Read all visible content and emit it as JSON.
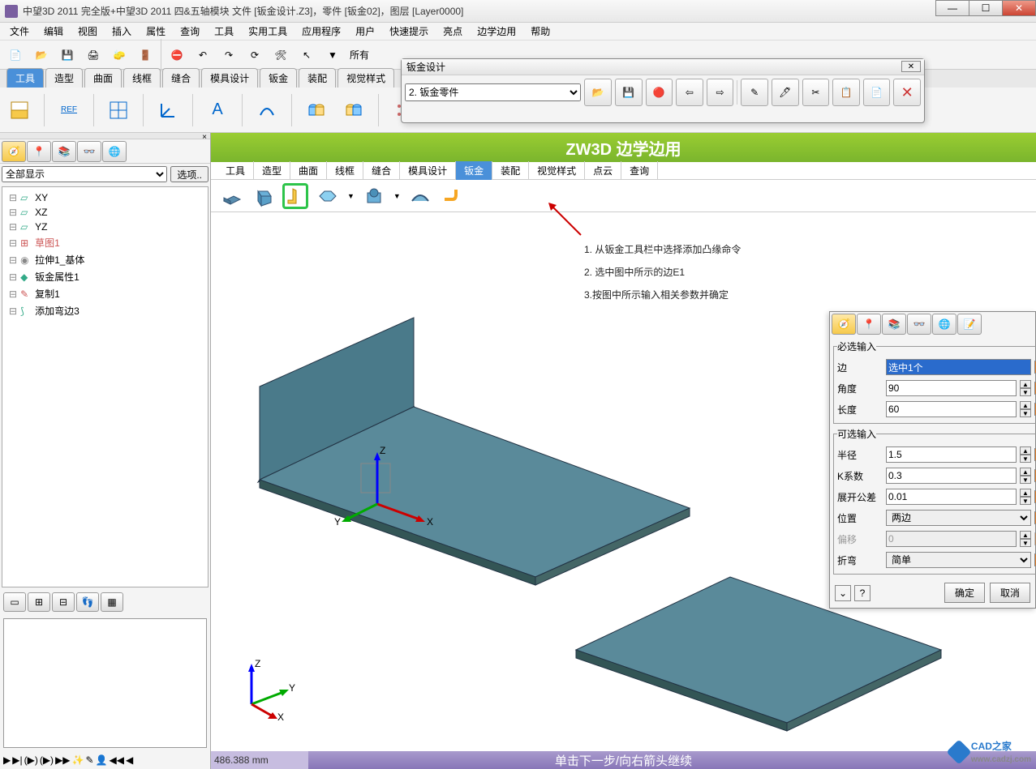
{
  "title": "中望3D 2011 完全版+中望3D 2011 四&五轴模块      文件 [钣金设计.Z3]，零件 [钣金02]，图层 [Layer0000]",
  "menu": [
    "文件",
    "编辑",
    "视图",
    "插入",
    "属性",
    "查询",
    "工具",
    "实用工具",
    "应用程序",
    "用户",
    "快速提示",
    "亮点",
    "边学边用",
    "帮助"
  ],
  "filterLabel": "所有",
  "mainTabs": [
    "工具",
    "造型",
    "曲面",
    "线框",
    "缝合",
    "模具设计",
    "钣金",
    "装配",
    "视觉样式"
  ],
  "mainActiveIdx": 0,
  "left": {
    "filter": "全部显示",
    "optionBtn": "选项..",
    "tree": [
      {
        "icon": "plane",
        "label": "XY"
      },
      {
        "icon": "plane",
        "label": "XZ"
      },
      {
        "icon": "plane",
        "label": "YZ"
      },
      {
        "icon": "sketch",
        "label": "草图1"
      },
      {
        "icon": "feat",
        "label": "拉伸1_基体"
      },
      {
        "icon": "sm",
        "label": "钣金属性1"
      },
      {
        "icon": "copy",
        "label": "复制1"
      },
      {
        "icon": "bend",
        "label": "添加弯边3"
      }
    ]
  },
  "floatToolbar": {
    "title": "钣金设计",
    "dropdown": "2. 钣金零件"
  },
  "banner": "ZW3D 边学边用",
  "innerTabs": [
    "工具",
    "造型",
    "曲面",
    "线框",
    "缝合",
    "模具设计",
    "钣金",
    "装配",
    "视觉样式",
    "点云",
    "查询"
  ],
  "innerActiveIdx": 6,
  "instructions": {
    "l1": "1. 从钣金工具栏中选择添加凸缘命令",
    "l2": "2. 选中图中所示的边E1",
    "l3": "3.按图中所示输入相关参数并确定"
  },
  "panel": {
    "group1": "必选输入",
    "group2": "可选输入",
    "rows": {
      "edge": {
        "label": "边",
        "value": "选中1个"
      },
      "angle": {
        "label": "角度",
        "value": "90"
      },
      "length": {
        "label": "长度",
        "value": "60"
      },
      "radius": {
        "label": "半径",
        "value": "1.5"
      },
      "kfactor": {
        "label": "K系数",
        "value": "0.3"
      },
      "tol": {
        "label": "展开公差",
        "value": "0.01"
      },
      "pos": {
        "label": "位置",
        "value": "两边"
      },
      "offset": {
        "label": "偏移",
        "value": "0"
      },
      "bend": {
        "label": "折弯",
        "value": "简单"
      }
    },
    "ok": "确定",
    "cancel": "取消"
  },
  "statusHint": "单击下一步/向右箭头继续",
  "statusMM": "486.388 mm",
  "watermark": {
    "brand": "CAD之家",
    "url": "www.cadzj.com"
  },
  "axisLabels": {
    "x": "X",
    "y": "Y",
    "z": "Z"
  },
  "originLabels": {
    "x": "X",
    "y": "Y",
    "z": "Z"
  }
}
